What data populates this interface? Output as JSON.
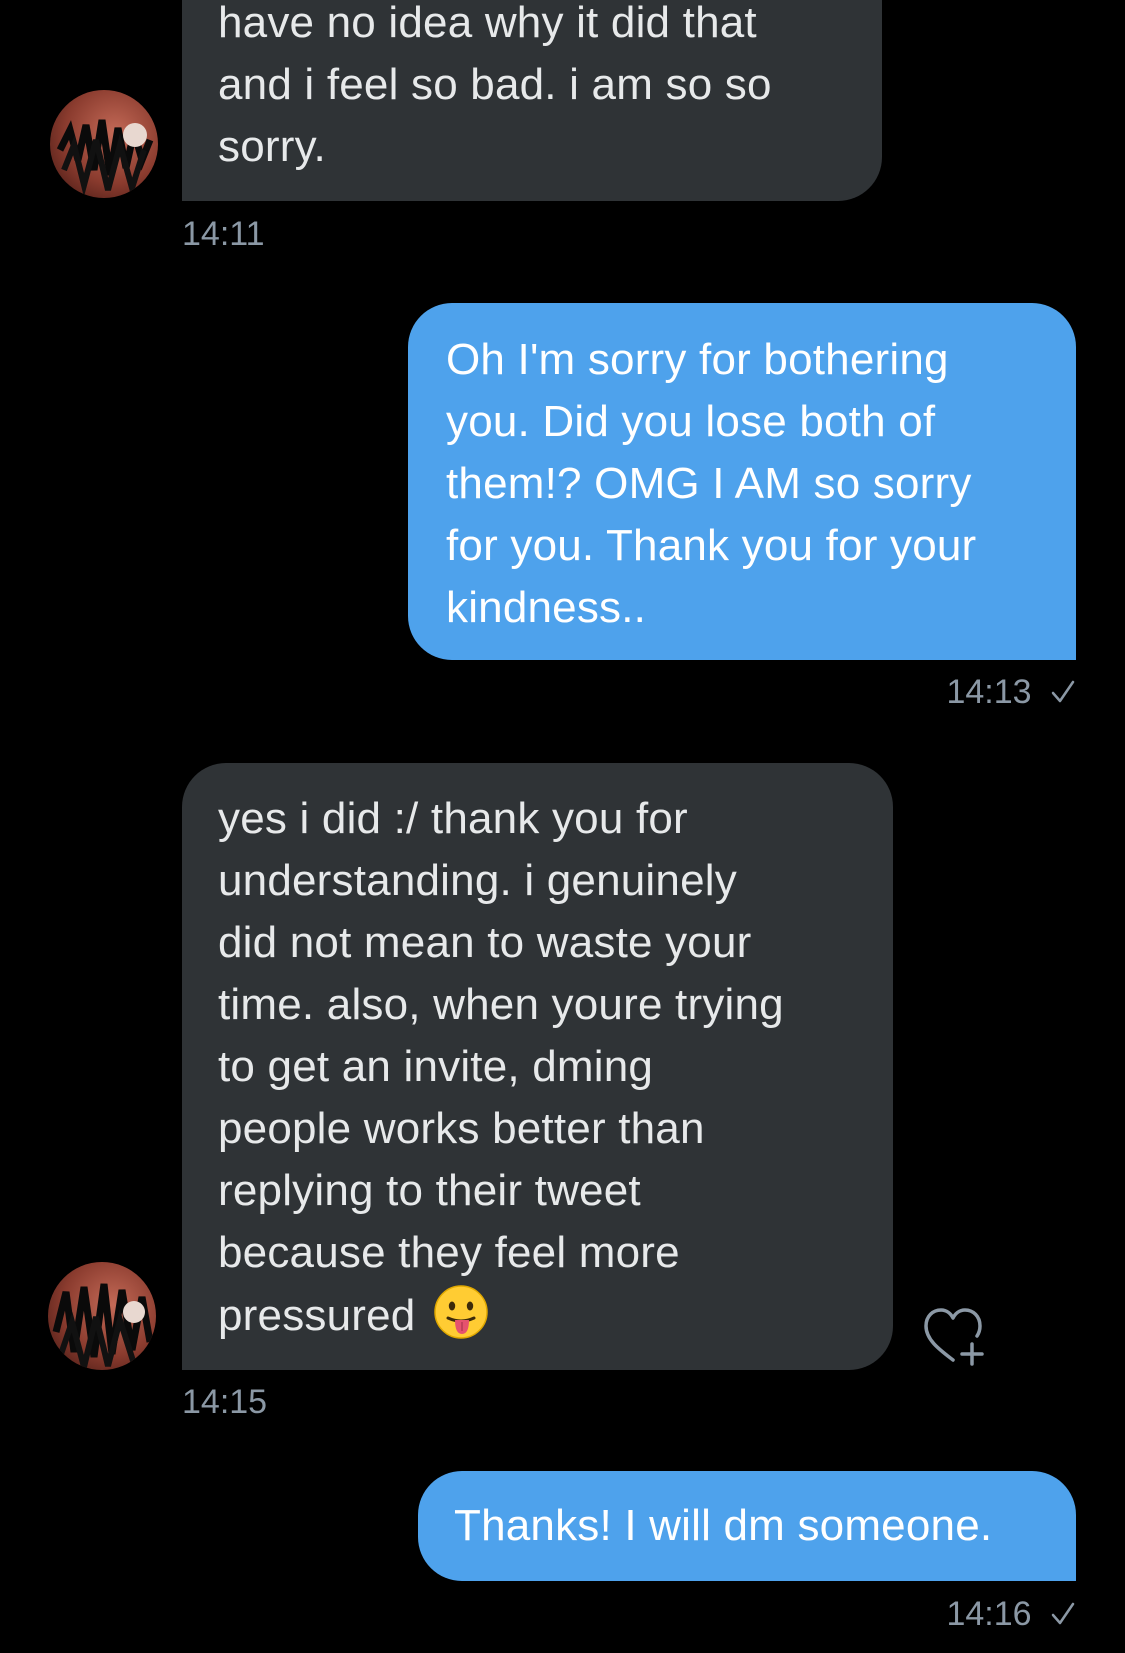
{
  "messages": [
    {
      "id": "m1",
      "direction": "incoming",
      "lines": [
        "have no idea why it did that",
        "and i feel so bad. i am so so",
        "sorry."
      ],
      "timestamp": "14:11"
    },
    {
      "id": "m2",
      "direction": "outgoing",
      "lines": [
        "Oh I'm sorry for bothering",
        "you. Did you lose both of",
        "them!? OMG I AM so sorry",
        "for you. Thank you for your",
        "kindness.."
      ],
      "timestamp": "14:13"
    },
    {
      "id": "m3",
      "direction": "incoming",
      "lines": [
        "yes i did :/ thank you for",
        "understanding. i genuinely",
        "did not mean to waste your",
        "time. also, when youre trying",
        "to get an invite, dming",
        "people works better than",
        "replying to their tweet",
        "because they feel more",
        "pressured"
      ],
      "emoji": "face-with-tongue",
      "timestamp": "14:15"
    },
    {
      "id": "m4",
      "direction": "outgoing",
      "lines": [
        "Thanks! I will dm someone."
      ],
      "timestamp": "14:16"
    }
  ],
  "icons": {
    "read_check": "checkmark-icon",
    "react": "heart-plus-icon",
    "emoji": "face-with-tongue-emoji"
  },
  "colors": {
    "background": "#000000",
    "incoming_bubble": "#2f3336",
    "outgoing_bubble": "#4ea2ec",
    "timestamp": "#8b98a5"
  }
}
